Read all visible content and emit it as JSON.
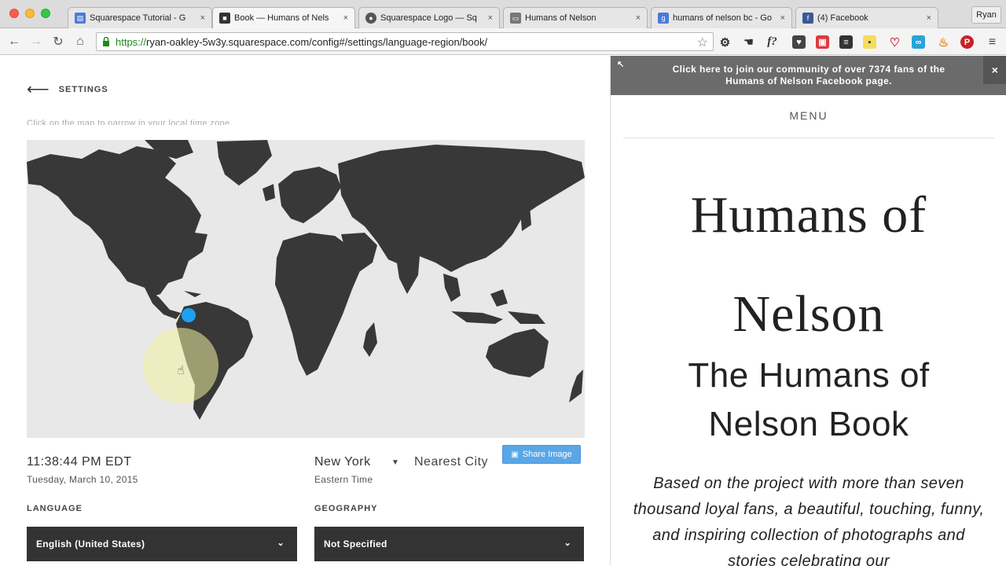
{
  "browser": {
    "tabs": [
      {
        "title": "Squarespace Tutorial - G",
        "favicon_color": "#4a7bd8",
        "favicon_glyph": "▤",
        "active": false
      },
      {
        "title": "Book — Humans of Nels",
        "favicon_color": "#333333",
        "favicon_glyph": "■",
        "active": true
      },
      {
        "title": "Squarespace Logo — Sq",
        "favicon_color": "#555555",
        "favicon_glyph": "●",
        "active": false
      },
      {
        "title": "Humans of Nelson",
        "favicon_color": "#777777",
        "favicon_glyph": "▭",
        "active": false
      },
      {
        "title": "humans of nelson bc - Go",
        "favicon_color": "#4a7bd8",
        "favicon_glyph": "g",
        "active": false
      },
      {
        "title": "(4) Facebook",
        "favicon_color": "#3b5998",
        "favicon_glyph": "f",
        "active": false
      }
    ],
    "tab_close": "×",
    "profile": "Ryan",
    "url_scheme": "https://",
    "url_rest": "ryan-oakley-5w3y.squarespace.com/config#/settings/language-region/book/"
  },
  "settings": {
    "back_label": "SETTINGS",
    "cut_text": "Click on the map to narrow in your local time zone",
    "time": "11:38:44 PM EDT",
    "date": "Tuesday, March 10, 2015",
    "city": "New York",
    "timezone": "Eastern Time",
    "nearest_city": "Nearest City",
    "share_label": "Share Image",
    "language_label": "LANGUAGE",
    "language_value": "English (United States)",
    "geography_label": "GEOGRAPHY",
    "geography_value": "Not Specified",
    "colors": {
      "marker": "#1da1f2",
      "land": "#383838",
      "ocean": "#e8e8e8",
      "cursor_halo": "#f2f0a0"
    }
  },
  "preview": {
    "fb_banner": "Click here to join our community of over 7374 fans of the Humans of Nelson Facebook page.",
    "fb_close": "×",
    "menu": "MENU",
    "title_line1": "Humans of",
    "title_line2": "Nelson",
    "subtitle_line1": "The Humans of",
    "subtitle_line2": "Nelson Book",
    "body": "Based on the project with more than seven thousand loyal fans, a beautiful, touching, funny, and inspiring collection of photographs and stories celebrating our"
  }
}
